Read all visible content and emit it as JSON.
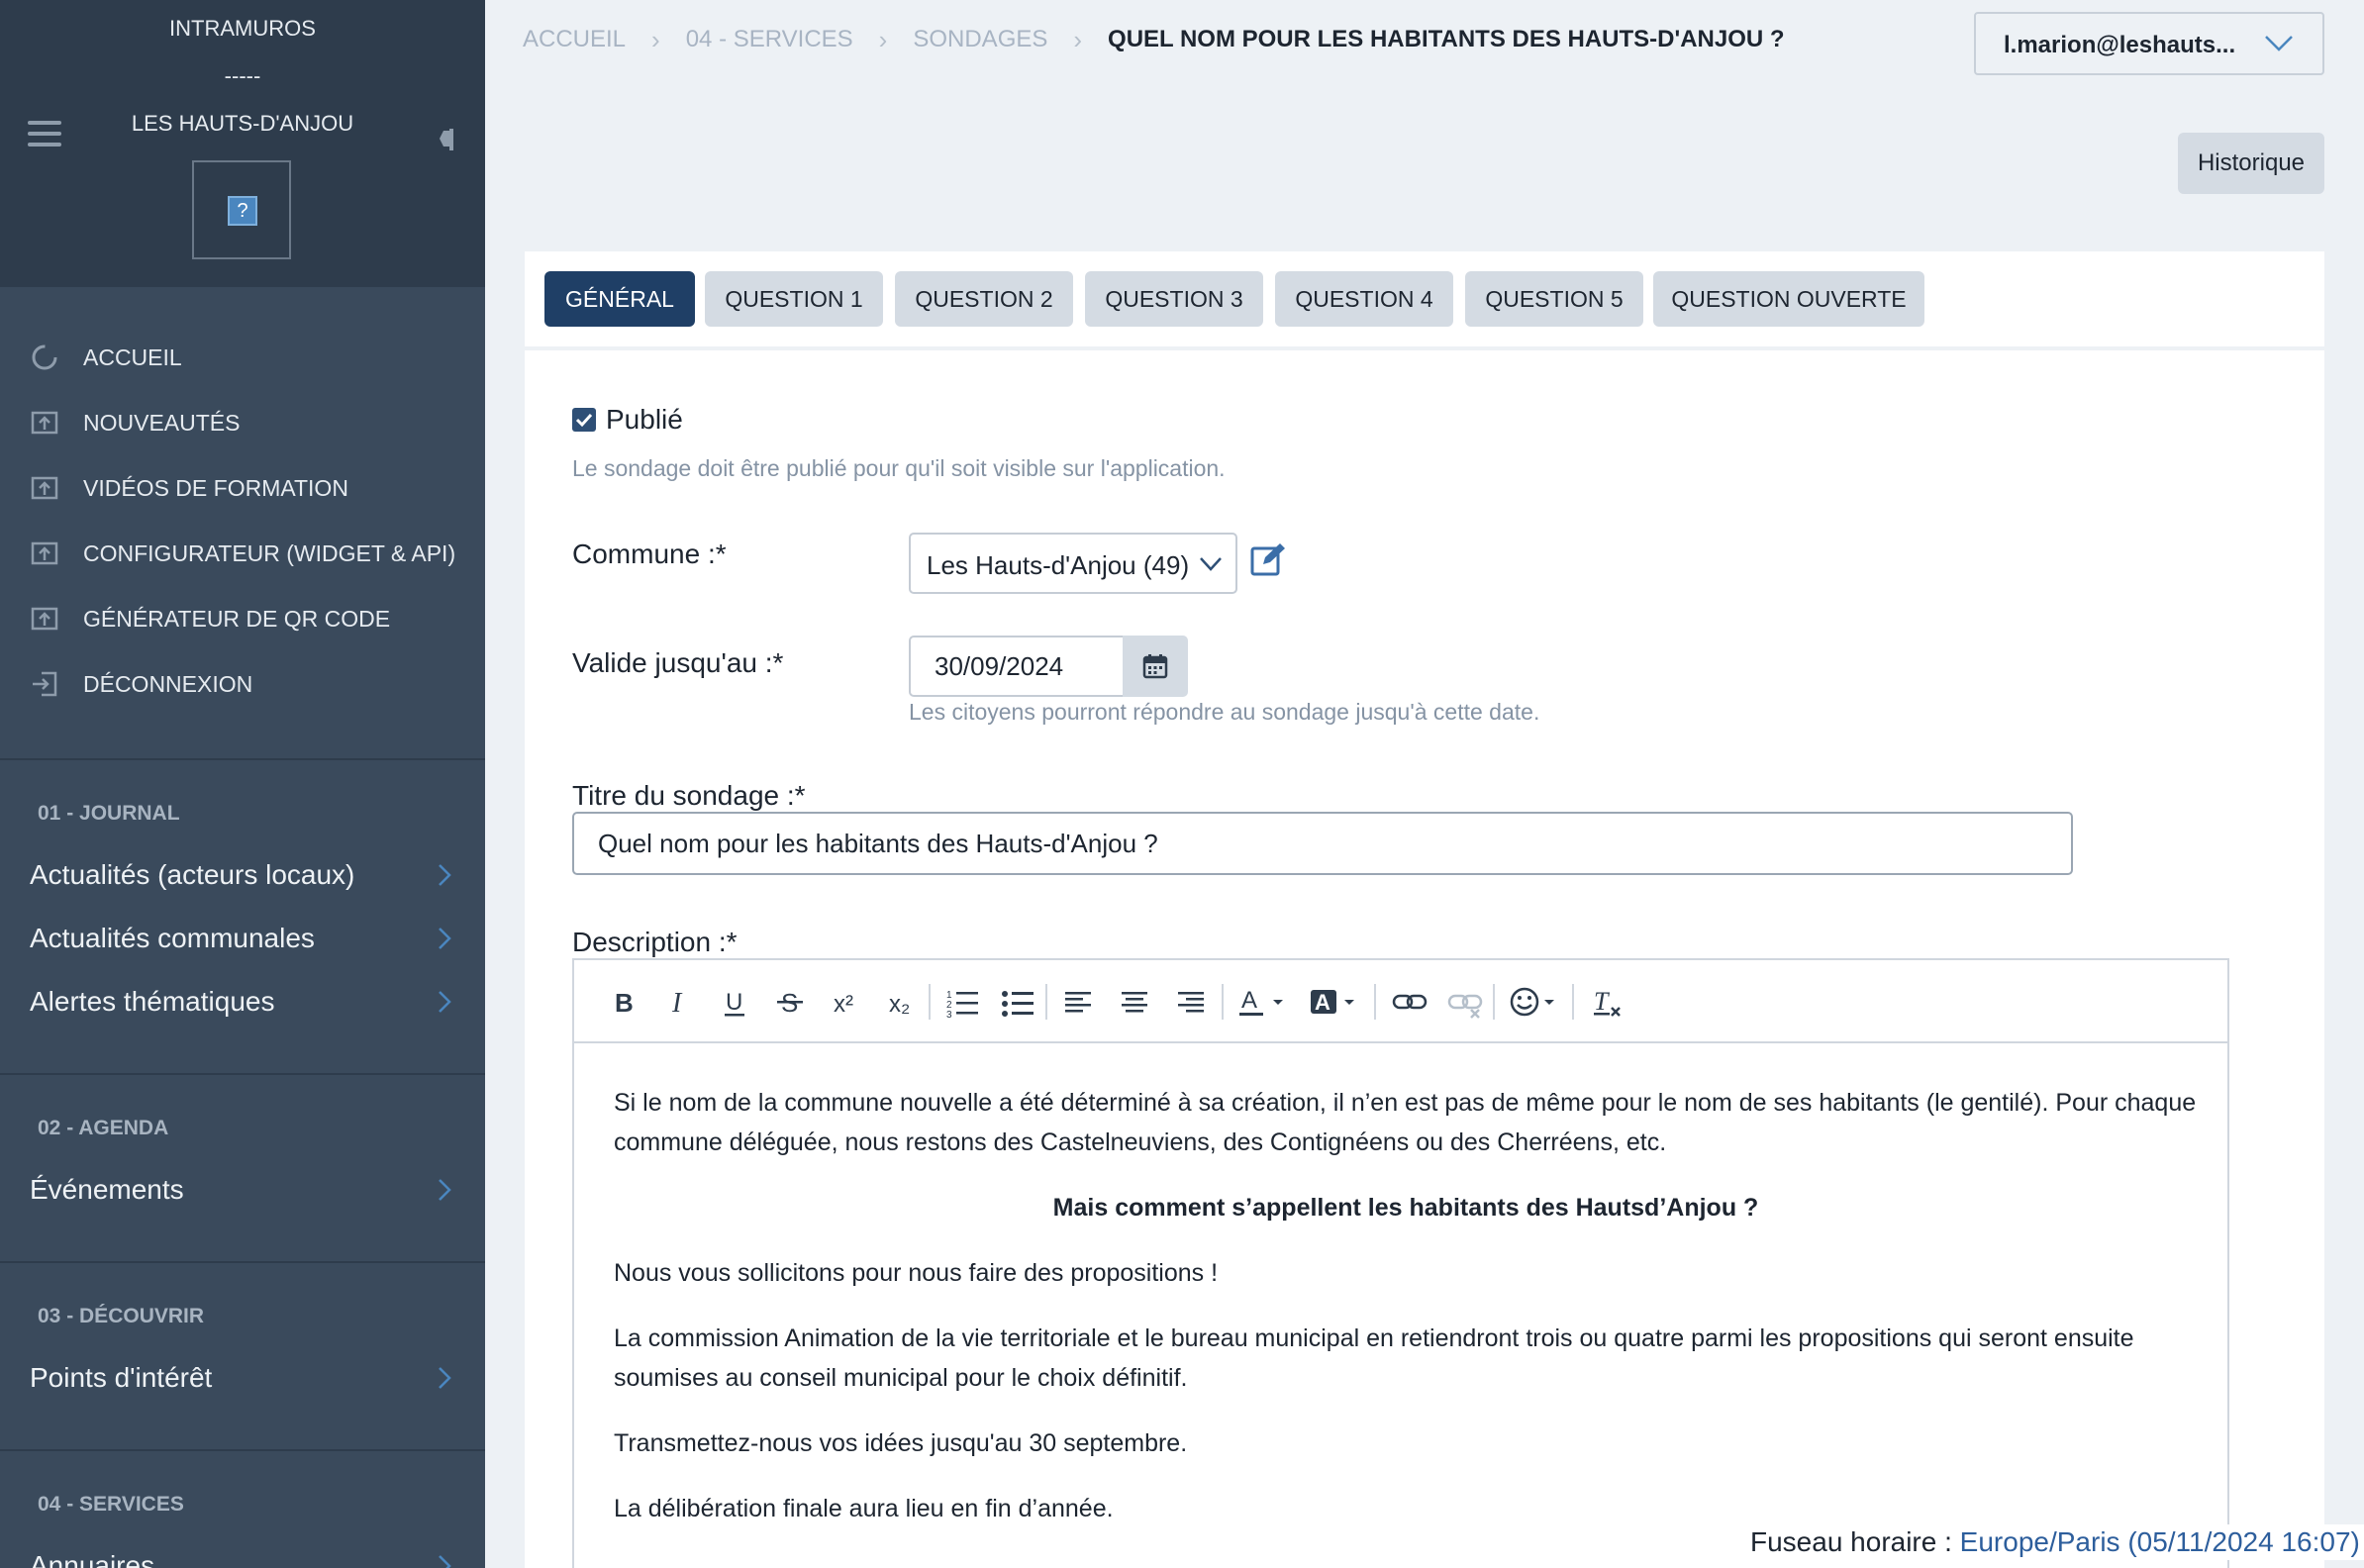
{
  "sidebar": {
    "brand_top": "INTRAMUROS",
    "brand_sep": "-----",
    "brand_name": "LES HAUTS-D'ANJOU",
    "logo_glyph": "?",
    "nav": [
      {
        "label": "ACCUEIL",
        "icon": "loading-circle-icon"
      },
      {
        "label": "NOUVEAUTÉS",
        "icon": "upload-box-icon"
      },
      {
        "label": "VIDÉOS DE FORMATION",
        "icon": "upload-box-icon"
      },
      {
        "label": "CONFIGURATEUR (WIDGET & API)",
        "icon": "upload-box-icon"
      },
      {
        "label": "GÉNÉRATEUR DE QR CODE",
        "icon": "upload-box-icon"
      },
      {
        "label": "DÉCONNEXION",
        "icon": "logout-icon"
      }
    ],
    "sections": [
      {
        "title": "01 - JOURNAL",
        "items": [
          "Actualités (acteurs locaux)",
          "Actualités communales",
          "Alertes thématiques"
        ]
      },
      {
        "title": "02 - AGENDA",
        "items": [
          "Événements"
        ]
      },
      {
        "title": "03 - DÉCOUVRIR",
        "items": [
          "Points d'intérêt"
        ]
      },
      {
        "title": "04 - SERVICES",
        "items": [
          "Annuaires"
        ]
      }
    ]
  },
  "breadcrumb": {
    "items": [
      "ACCUEIL",
      "04 - SERVICES",
      "SONDAGES"
    ],
    "current": "QUEL NOM POUR LES HABITANTS DES HAUTS-D'ANJOU ?"
  },
  "user": {
    "email": "l.marion@leshauts..."
  },
  "historique_label": "Historique",
  "tabs": [
    "GÉNÉRAL",
    "QUESTION 1",
    "QUESTION 2",
    "QUESTION 3",
    "QUESTION 4",
    "QUESTION 5",
    "QUESTION OUVERTE"
  ],
  "form": {
    "published_label": "Publié",
    "published": true,
    "published_help": "Le sondage doit être publié pour qu'il soit visible sur l'application.",
    "commune_label": "Commune :*",
    "commune_value": "Les Hauts-d'Anjou (49)",
    "valid_label": "Valide jusqu'au :*",
    "valid_value": "30/09/2024",
    "valid_help": "Les citoyens pourront répondre au sondage jusqu'à cette date.",
    "title_label": "Titre du sondage :*",
    "title_value": "Quel nom pour les habitants des Hauts-d'Anjou ?",
    "description_label": "Description :*"
  },
  "description": {
    "p1": "Si le nom de la commune nouvelle a été déterminé à sa création, il n’en est pas de même pour le nom de ses habitants (le gentilé). Pour chaque commune déléguée, nous restons des Castelneuviens, des Contignéens ou des Cherréens, etc.",
    "p2": "Mais comment s’appellent les habitants des Hautsd’Anjou ?",
    "p3": "Nous vous sollicitons pour nous faire des propositions !",
    "p4": "La commission Animation de la vie territoriale et le bureau municipal en retiendront trois ou quatre parmi les propositions qui seront ensuite soumises au conseil municipal pour le choix définitif.",
    "p5": "Transmettez-nous vos idées jusqu'au 30 septembre.",
    "p6": "La délibération finale aura lieu en fin d’année."
  },
  "toolbar_glyphs": {
    "bold": "B",
    "italic": "I",
    "underline": "U",
    "strike": "S",
    "sup": "x²",
    "sub": "x₂",
    "font_color": "A",
    "bg_color": "A",
    "clear": "T"
  },
  "footer": {
    "tz_label": "Fuseau horaire : ",
    "tz_value": "Europe/Paris (05/11/2024 16:07)"
  },
  "colors": {
    "sidebar_bg": "#3a4a5c",
    "sidebar_head_bg": "#2e3c4c",
    "active_tab": "#1f3f66",
    "link": "#2d5e9c"
  }
}
